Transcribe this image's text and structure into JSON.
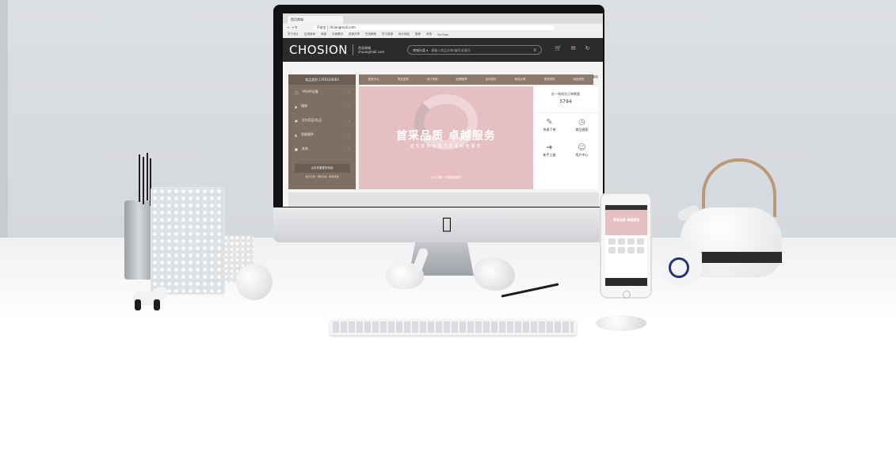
{
  "browser": {
    "tab_title": "首页商城",
    "url": "不安全 | chuangmall.com",
    "bookmarks": [
      "关于设计",
      "应用案例",
      "商城",
      "平面素材",
      "资源共享",
      "在线教程",
      "学习资源",
      "设计网站",
      "推荐",
      "其他",
      "YouTube"
    ]
  },
  "site": {
    "logo": "CHOSION",
    "logo_sub_1": "首采商城",
    "logo_sub_2": "chuangmall.com",
    "search_scope": "商城分类 ▾",
    "search_placeholder": "请输入商品名称/编号关键词"
  },
  "category": {
    "title": "商品类别 CATEGORIES",
    "items": [
      "VR/AR设备",
      "服饰",
      "文化用品/礼品",
      "智能硬件",
      "其他"
    ],
    "button": "点击查看更多商品",
    "links": "客户订单 · 领取方案 · 推荐营销"
  },
  "menu": [
    "首页中心",
    "项目定制",
    "设计采购",
    "品牌推荐",
    "活动资讯",
    "商品分类",
    "常规采购",
    "商品采购"
  ],
  "banner": {
    "title": "首采品质 卓越服务",
    "subtitle": "首先的好采购方案提供者服务",
    "note": "点击了解 · 在线客服服务"
  },
  "side_panel": {
    "label": "近一周成交订单数量",
    "count": "5794",
    "cells": [
      {
        "icon": "clipboard-icon",
        "label": "快速下单"
      },
      {
        "icon": "clock-icon",
        "label": "商品搜索"
      },
      {
        "icon": "signpost-icon",
        "label": "新手上路"
      },
      {
        "icon": "user-icon",
        "label": "用户中心"
      }
    ]
  },
  "corner_label": "返回"
}
